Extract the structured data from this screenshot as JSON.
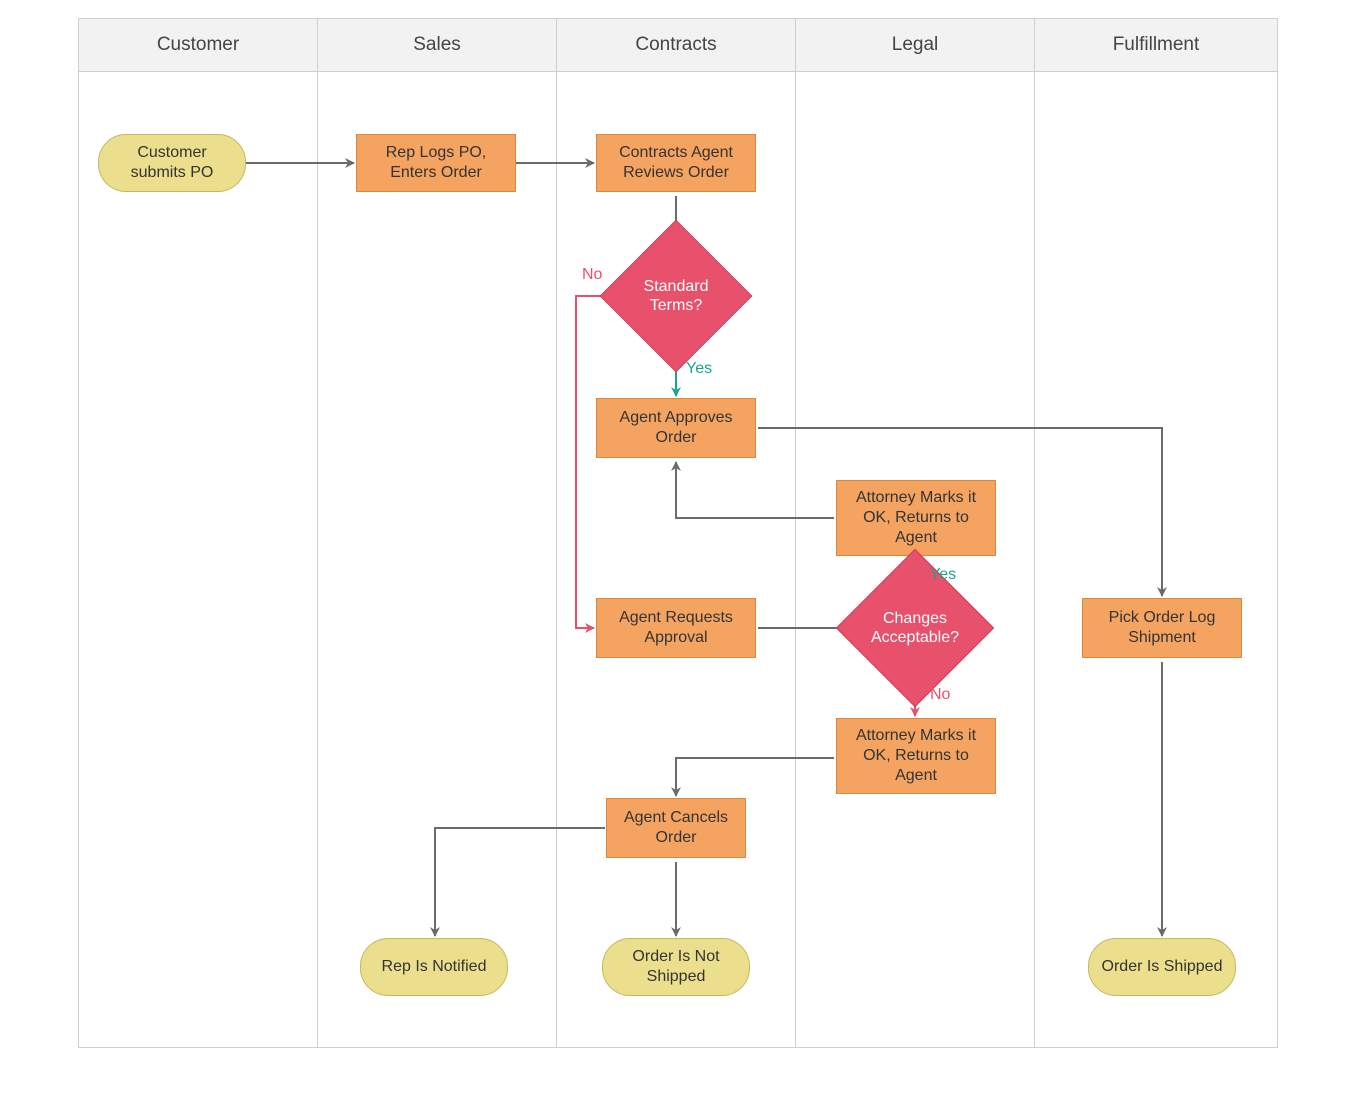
{
  "lanes": {
    "customer": "Customer",
    "sales": "Sales",
    "contracts": "Contracts",
    "legal": "Legal",
    "fulfillment": "Fulfillment"
  },
  "nodes": {
    "start": "Customer submits PO",
    "rep_logs": "Rep Logs PO, Enters Order",
    "reviews": "Contracts Agent Reviews Order",
    "standard_terms": "Standard Terms?",
    "approves": "Agent Approves Order",
    "attorney_ok": "Attorney Marks it OK, Returns to Agent",
    "requests_approval": "Agent Requests Approval",
    "changes_acceptable": "Changes Acceptable?",
    "attorney_ok2": "Attorney Marks it OK, Returns to Agent",
    "pick_order": "Pick Order Log Shipment",
    "cancels": "Agent Cancels Order",
    "rep_notified": "Rep Is Notified",
    "not_shipped": "Order Is Not Shipped",
    "shipped": "Order Is Shipped"
  },
  "edges": {
    "no": "No",
    "yes": "Yes"
  },
  "colors": {
    "process": "#f4a460",
    "terminator": "#ebde8c",
    "decision": "#e7516b",
    "arrow": "#6b6b6b",
    "arrow_yes": "#1aa58f",
    "arrow_no": "#e7516b"
  }
}
